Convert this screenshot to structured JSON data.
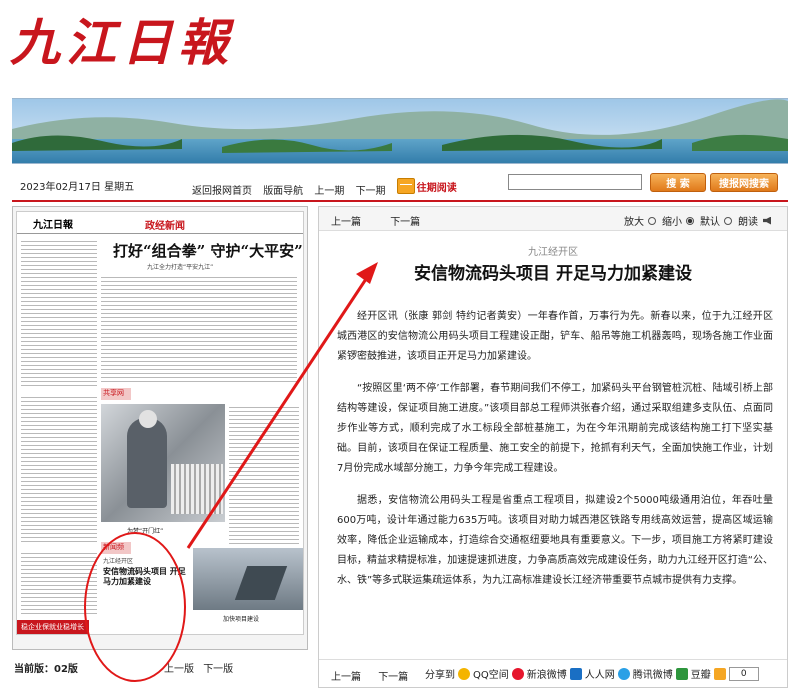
{
  "masthead": {
    "title": "九江日報"
  },
  "toolbar": {
    "date": "2023年02月17日 星期五",
    "home_link": "返回报网首页",
    "layout_nav": "版面导航",
    "prev_issue": "上一期",
    "next_issue": "下一期",
    "past_reading": "往期阅读",
    "search_placeholder": "",
    "search_button": "搜 索",
    "net_search_button": "搜报网搜索"
  },
  "thumbnail": {
    "paper_name": "九江日報",
    "section": "政经新闻",
    "headline": "打好“组合拳” 守护“大平安”",
    "subheadline": "九江全力打造“平安九江”",
    "photo_label": "共享网",
    "photo_caption": "为梦“开门红”",
    "pink_label_2": "新闻频",
    "mini_kicker": "九江经开区",
    "mini_headline": "安信物流码头项目 开足马力加紧建设",
    "photo2_caption": "加快项目建设",
    "bottom_bar": "稳企业保就业稳增长"
  },
  "left_footer": {
    "current_label": "当前版：",
    "current_value": "02版",
    "prev_page": "上一版",
    "next_page": "下一版"
  },
  "article_nav": {
    "prev": "上一篇",
    "next": "下一篇",
    "zoom_in": "放大",
    "zoom_out": "缩小",
    "default": "默认",
    "read_aloud": "朗读"
  },
  "article": {
    "kicker": "九江经开区",
    "headline": "安信物流码头项目  开足马力加紧建设",
    "paragraphs": [
      "经开区讯（张康 郭剑 特约记者黄安）一年春作首，万事行为先。新春以来，位于九江经开区城西港区的安信物流公用码头项目工程建设正酣，铲车、船吊等施工机器轰鸣，现场各施工作业面紧锣密鼓推进，该项目正开足马力加紧建设。",
      "“按照区里‘两不停’工作部署，春节期间我们不停工，加紧码头平台钢管桩沉桩、陆域引桥上部结构等建设，保证项目施工进度。”该项目部总工程师洪张春介绍，通过采取组建多支队伍、点面同步作业等方式，顺利完成了水工标段全部桩基施工，为在今年汛期前完成该结构施工打下坚实基础。目前，该项目在保证工程质量、施工安全的前提下，抢抓有利天气，全面加快施工作业，计划7月份完成水域部分施工，力争今年完成工程建设。",
      "据悉，安信物流公用码头工程是省重点工程项目，拟建设2个5000吨级通用泊位，年吞吐量600万吨，设计年通过能力635万吨。该项目对助力城西港区铁路专用线高效运营，提高区域运输效率，降低企业运输成本，打造综合交通枢纽要地具有重要意义。下一步，项目施工方将紧盯建设目标，精益求精提标准，加速提速抓进度，力争高质高效完成建设任务，助力九江经开区打造“公、水、铁”等多式联运集疏运体系，为九江高标准建设长江经济带重要节点城市提供有力支撑。"
    ]
  },
  "footer": {
    "prev": "上一篇",
    "next": "下一篇",
    "share_label": "分享到",
    "share_targets": [
      "QQ空间",
      "新浪微博",
      "人人网",
      "腾讯微博",
      "豆瓣"
    ],
    "share_count": "0"
  },
  "colors": {
    "brand_red": "#c8161d",
    "button_orange": "#e0791a",
    "annotation_red": "#e01818"
  }
}
